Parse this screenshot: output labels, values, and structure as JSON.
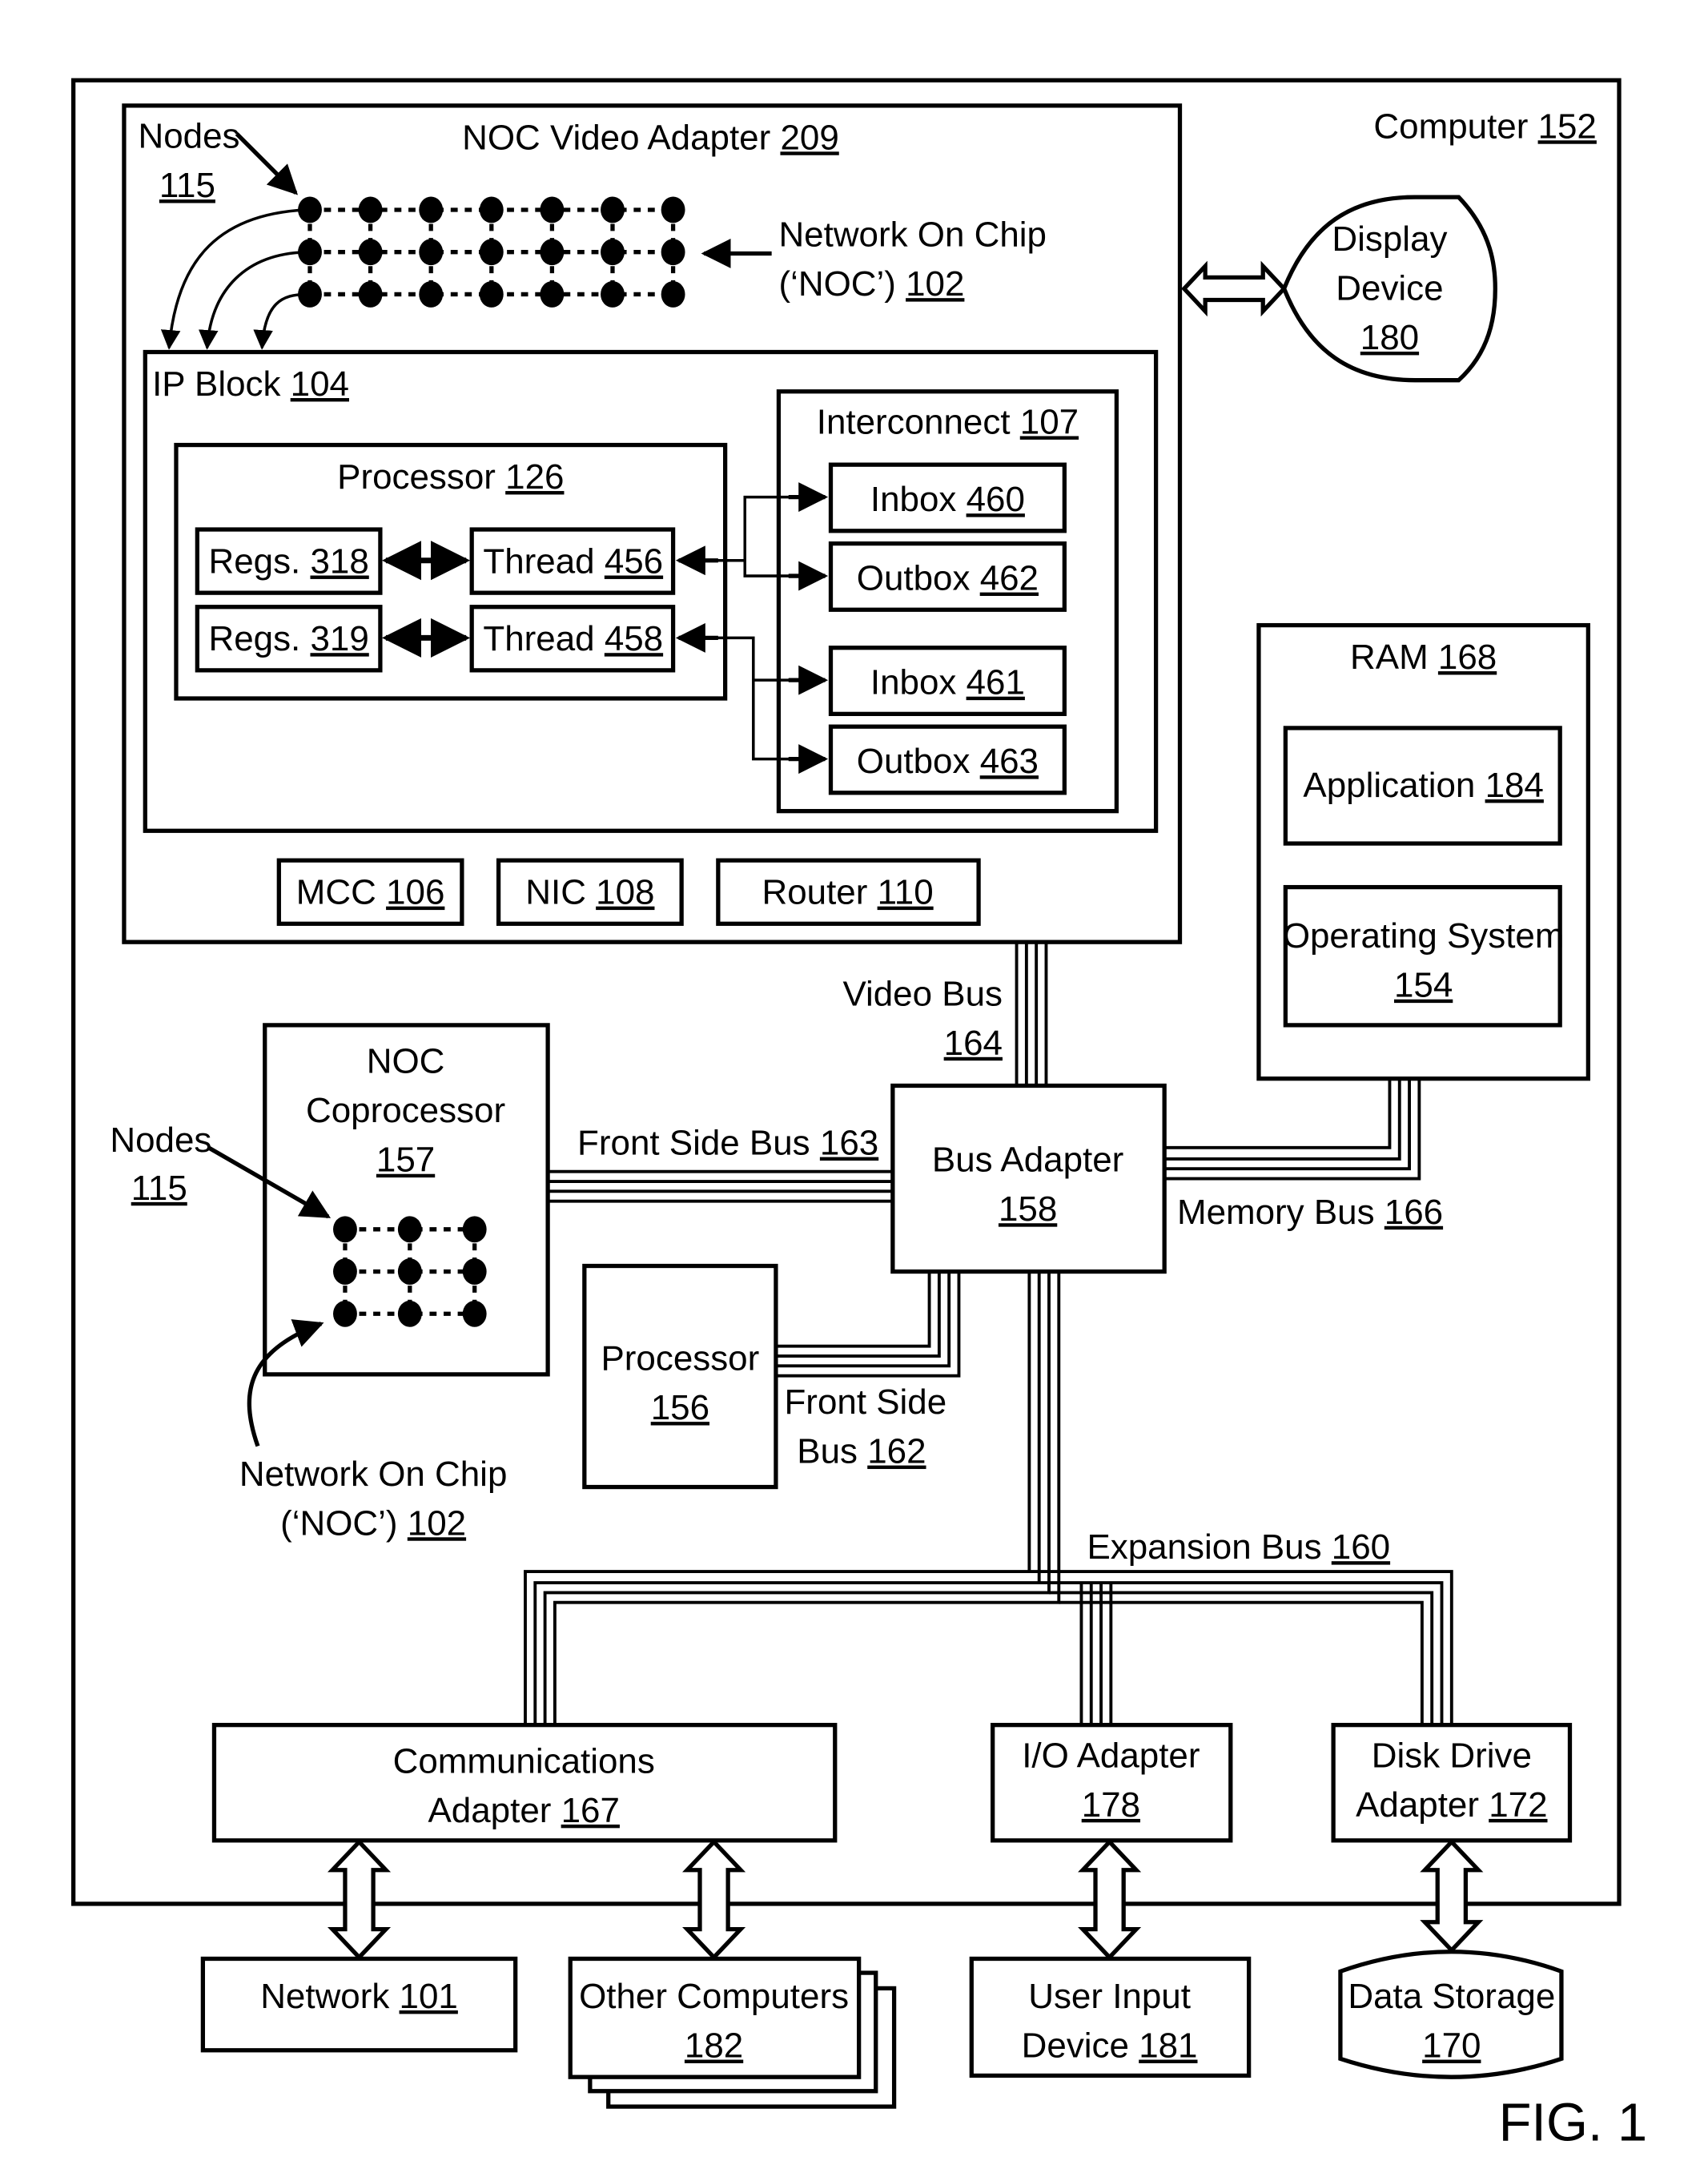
{
  "figure_label": "FIG. 1",
  "computer": {
    "name": "Computer",
    "ref": "152"
  },
  "noc_video_adapter": {
    "name": "NOC Video Adapter",
    "ref": "209"
  },
  "nodes_top": {
    "name": "Nodes",
    "ref": "115"
  },
  "noc_top": {
    "line1": "Network On Chip",
    "line2": "(‘NOC’)",
    "ref": "102"
  },
  "ip_block": {
    "name": "IP Block",
    "ref": "104"
  },
  "processor_126": {
    "name": "Processor",
    "ref": "126"
  },
  "regs_318": {
    "name": "Regs.",
    "ref": "318"
  },
  "regs_319": {
    "name": "Regs.",
    "ref": "319"
  },
  "thread_456": {
    "name": "Thread",
    "ref": "456"
  },
  "thread_458": {
    "name": "Thread",
    "ref": "458"
  },
  "interconnect": {
    "name": "Interconnect",
    "ref": "107"
  },
  "inbox_460": {
    "name": "Inbox",
    "ref": "460"
  },
  "outbox_462": {
    "name": "Outbox",
    "ref": "462"
  },
  "inbox_461": {
    "name": "Inbox",
    "ref": "461"
  },
  "outbox_463": {
    "name": "Outbox",
    "ref": "463"
  },
  "mcc": {
    "name": "MCC",
    "ref": "106"
  },
  "nic": {
    "name": "NIC",
    "ref": "108"
  },
  "router": {
    "name": "Router",
    "ref": "110"
  },
  "display_device": {
    "line1": "Display",
    "line2": "Device",
    "ref": "180"
  },
  "ram": {
    "name": "RAM",
    "ref": "168"
  },
  "application": {
    "name": "Application",
    "ref": "184"
  },
  "operating_system": {
    "name": "Operating System",
    "ref": "154"
  },
  "video_bus": {
    "name": "Video Bus",
    "ref": "164"
  },
  "bus_adapter": {
    "name": "Bus Adapter",
    "ref": "158"
  },
  "memory_bus": {
    "name": "Memory Bus",
    "ref": "166"
  },
  "noc_coprocessor": {
    "line1": "NOC",
    "line2": "Coprocessor",
    "ref": "157"
  },
  "nodes_bottom": {
    "name": "Nodes",
    "ref": "115"
  },
  "noc_bottom": {
    "line1": "Network On Chip",
    "line2": "(‘NOC’)",
    "ref": "102"
  },
  "front_side_bus_163": {
    "name": "Front Side Bus",
    "ref": "163"
  },
  "processor_156": {
    "name": "Processor",
    "ref": "156"
  },
  "front_side_bus_162": {
    "line1": "Front Side",
    "line2": "Bus",
    "ref": "162"
  },
  "expansion_bus": {
    "name": "Expansion Bus",
    "ref": "160"
  },
  "communications_adapter": {
    "line1": "Communications",
    "line2": "Adapter",
    "ref": "167"
  },
  "io_adapter": {
    "line1": "I/O Adapter",
    "ref": "178"
  },
  "disk_drive_adapter": {
    "line1": "Disk Drive",
    "line2": "Adapter",
    "ref": "172"
  },
  "network": {
    "name": "Network",
    "ref": "101"
  },
  "other_computers": {
    "name": "Other Computers",
    "ref": "182"
  },
  "user_input_device": {
    "line1": "User Input",
    "line2": "Device",
    "ref": "181"
  },
  "data_storage": {
    "name": "Data Storage",
    "ref": "170"
  }
}
